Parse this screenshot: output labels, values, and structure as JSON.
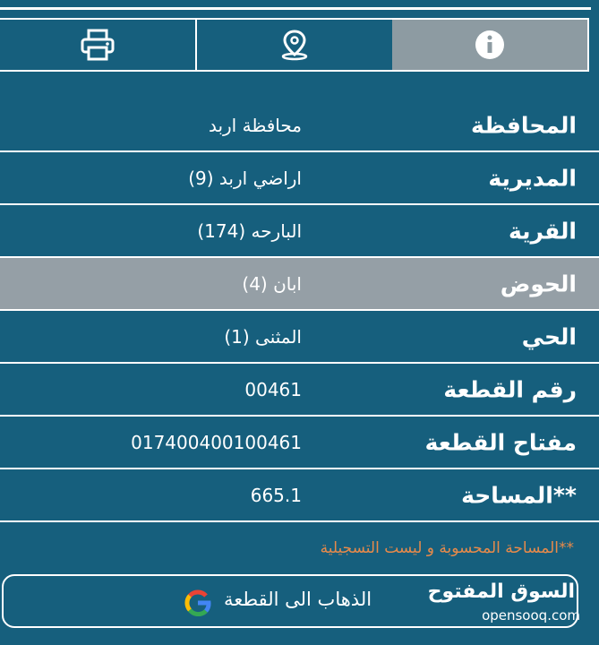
{
  "tabs": [
    {
      "id": "print",
      "icon": "printer-icon"
    },
    {
      "id": "location",
      "icon": "map-pin-icon"
    },
    {
      "id": "info",
      "icon": "info-icon",
      "active": true
    }
  ],
  "rows": [
    {
      "label": "المحافظة",
      "value": "محافظة اربد"
    },
    {
      "label": "المديرية",
      "value": "اراضي اربد (9)"
    },
    {
      "label": "القرية",
      "value": "البارحه (174)"
    },
    {
      "label": "الحوض",
      "value": "ابان (4)",
      "highlight": true
    },
    {
      "label": "الحي",
      "value": "المثنى (1)"
    },
    {
      "label": "رقم القطعة",
      "value": "00461"
    },
    {
      "label": "مفتاح القطعة",
      "value": "017400400100461"
    },
    {
      "label": "**المساحة",
      "value": "665.1"
    }
  ],
  "note": "**المساحة المحسوبة و ليست التسجيلية",
  "goto_button": {
    "label": "الذهاب الى القطعة",
    "icon": "google-icon"
  },
  "watermark": {
    "arabic": "السوق المفتوح",
    "english": "opensooq.com"
  },
  "colors": {
    "background": "#165f7d",
    "active_tab": "#8d9ba2",
    "highlight_row": "#959fa6",
    "note": "#e88a4a"
  }
}
